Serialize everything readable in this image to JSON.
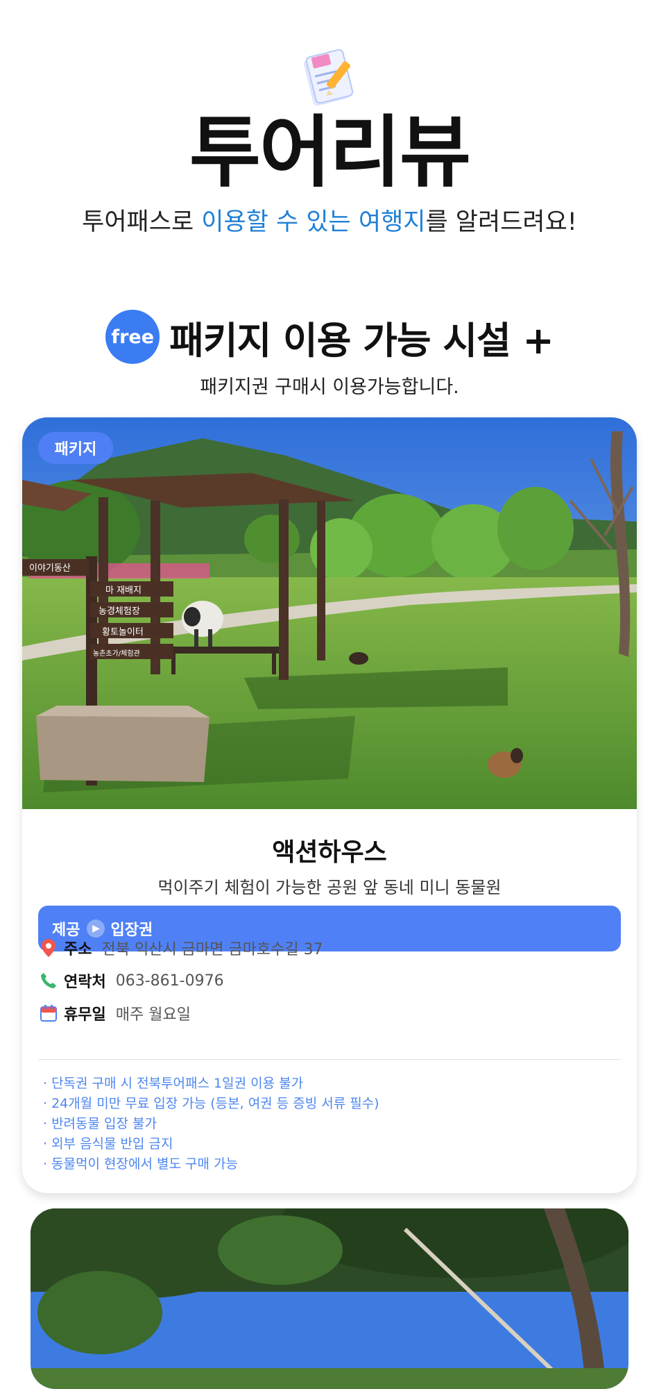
{
  "hero": {
    "icon": "notepad-pencil-icon",
    "title": "투어리뷰",
    "subtitle_pre": "투어패스로 ",
    "subtitle_highlight": "이용할 수 있는 여행지",
    "subtitle_post": "를 알려드려요!"
  },
  "section": {
    "badge": "free",
    "title": "패키지 이용 가능 시설 +",
    "subtitle": "패키지권 구매시 이용가능합니다."
  },
  "card": {
    "badge": "패키지",
    "signs": [
      "이야기동산",
      "마 재배지",
      "농경체험장",
      "황토놀이터",
      "농촌초가/체험관"
    ],
    "name": "액션하우스",
    "description": "먹이주기 체험이 가능한 공원 앞 동네 미니 동물원",
    "offer_label": "제공",
    "offer_value": "입장권",
    "info": {
      "address_label": "주소",
      "address_value": "전북 익산시 금마면 금마호수길 37",
      "contact_label": "연락처",
      "contact_value": "063-861-0976",
      "closed_label": "휴무일",
      "closed_value": "매주 월요일"
    },
    "notes": [
      "· 단독권 구매 시 전북투어패스 1일권 이용 불가",
      "· 24개월 미만 무료 입장 가능 (등본, 여권 등 증빙 서류 필수)",
      "· 반려동물 입장 불가",
      "· 외부 음식물 반입 금지",
      "· 동물먹이 현장에서 별도 구매 가능"
    ]
  },
  "colors": {
    "accent_blue": "#4f80f5",
    "highlight_text": "#1f7fd6",
    "note_text": "#4d86ef"
  }
}
